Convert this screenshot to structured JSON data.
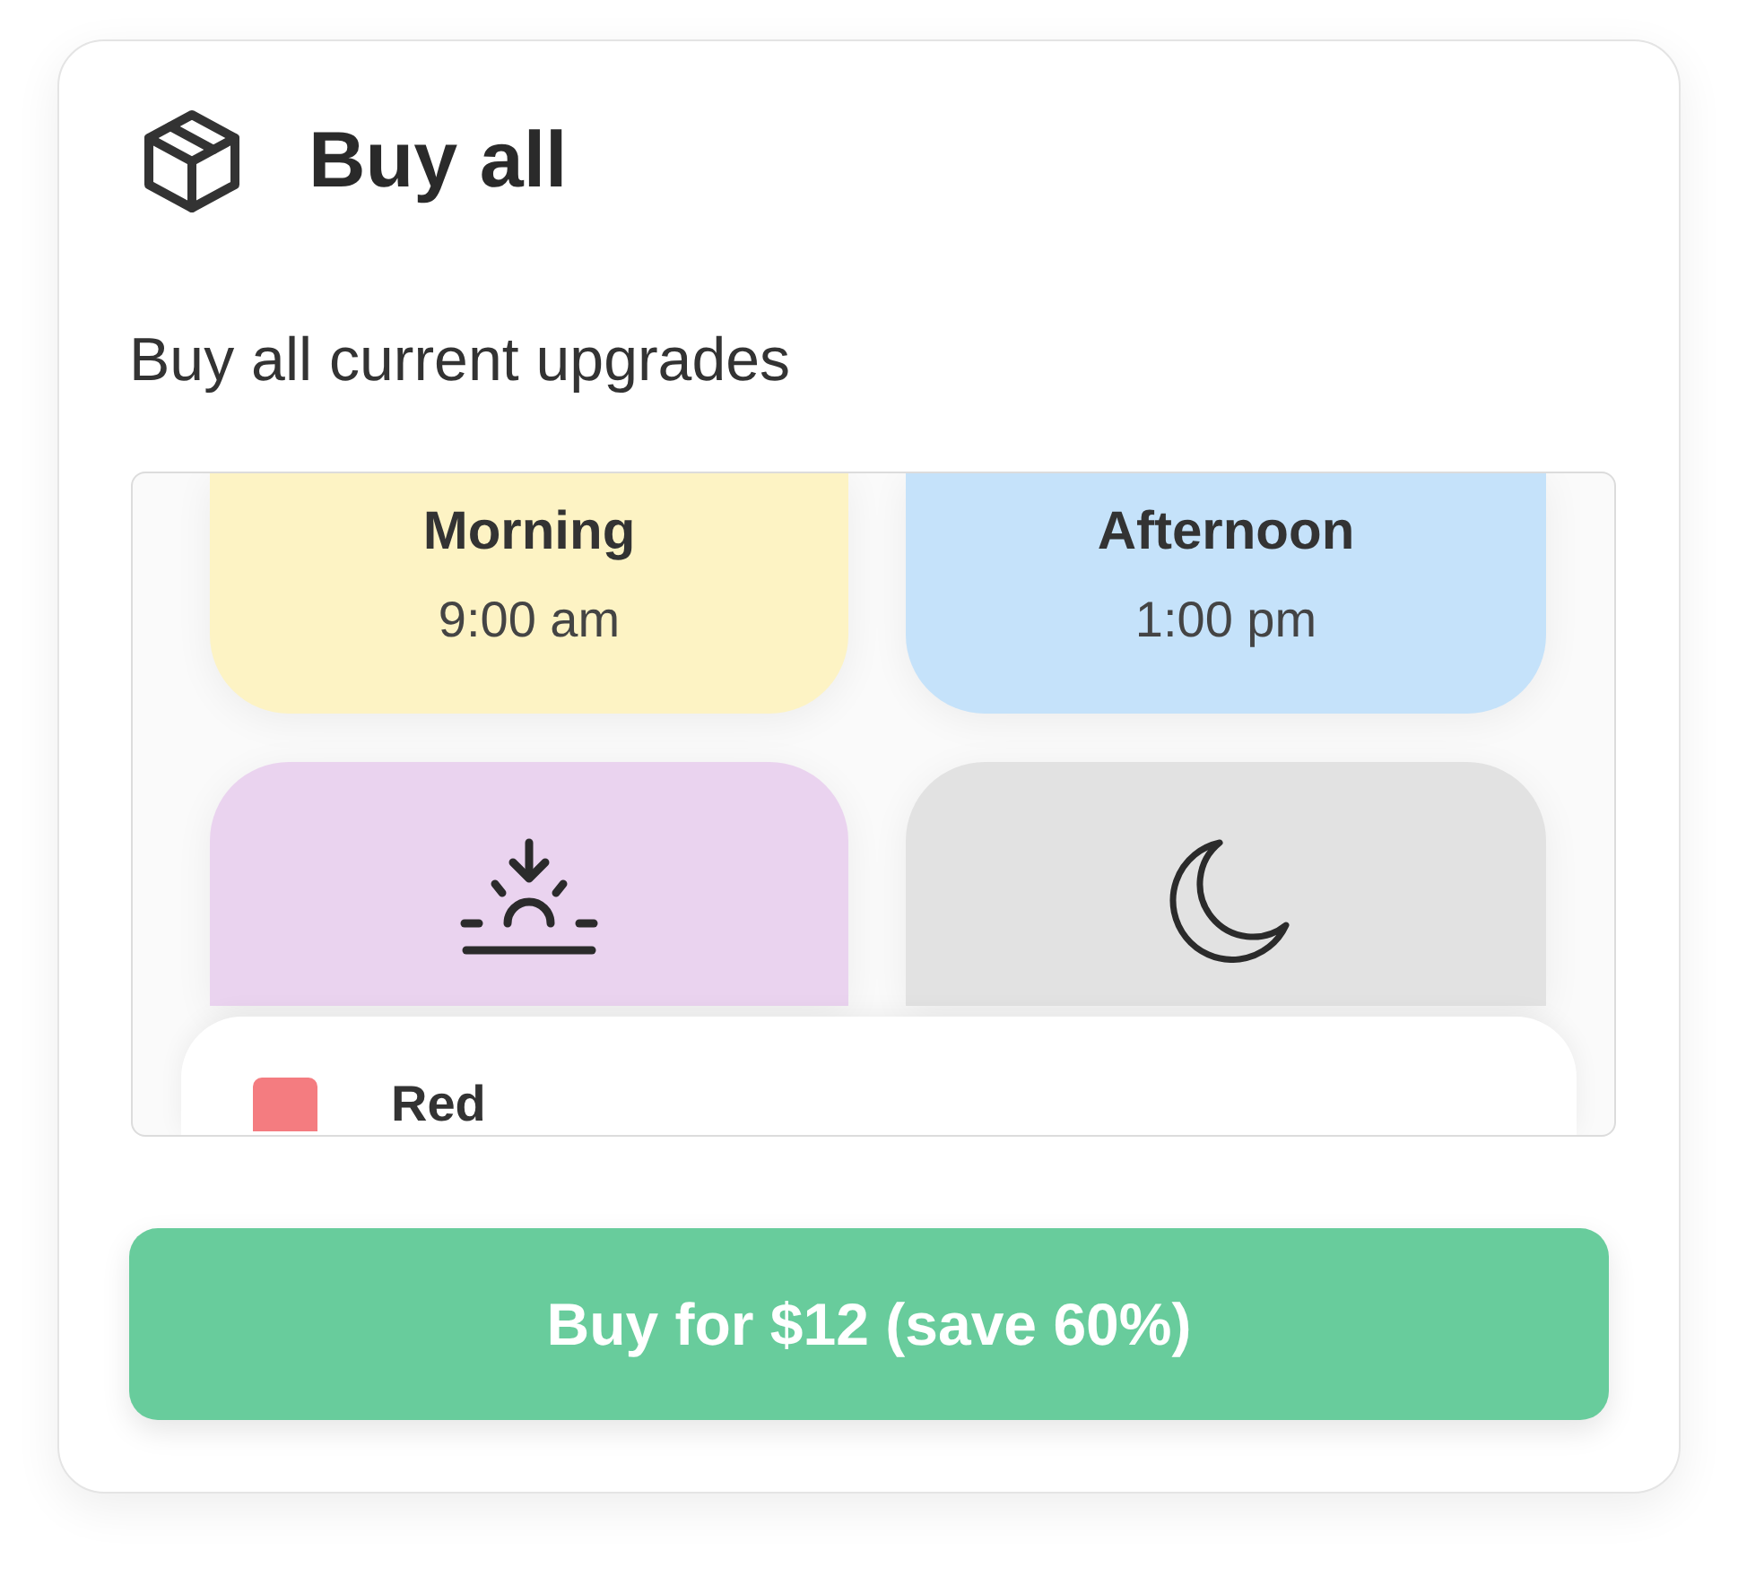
{
  "header": {
    "title": "Buy all"
  },
  "description": "Buy all current upgrades",
  "preview": {
    "tiles": [
      {
        "kind": "text",
        "title": "Morning",
        "time": "9:00 am",
        "color": "#fdf3c4"
      },
      {
        "kind": "text",
        "title": "Afternoon",
        "time": "1:00 pm",
        "color": "#c5e2fa"
      },
      {
        "kind": "sunrise",
        "color": "#ead3ef"
      },
      {
        "kind": "moon",
        "color": "#e2e2e2"
      }
    ],
    "color_rows": [
      {
        "name": "Red",
        "color": "#f47c80"
      }
    ]
  },
  "button": {
    "label": "Buy for $12 (save 60%)"
  }
}
